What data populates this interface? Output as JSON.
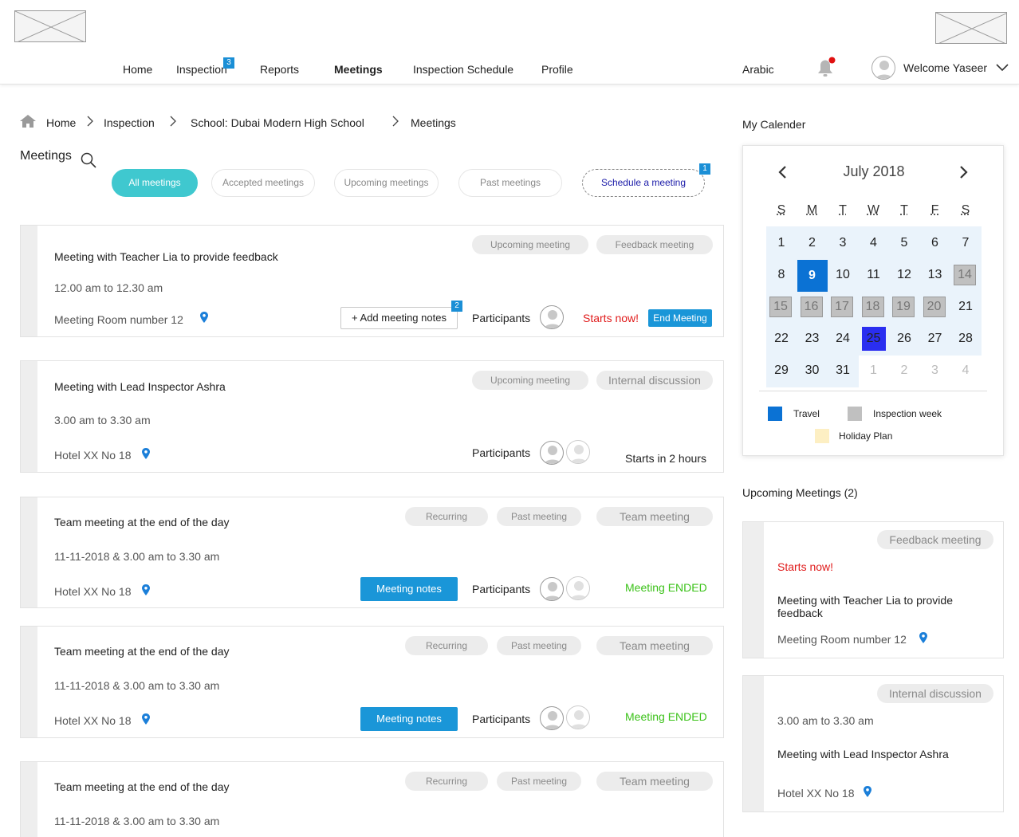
{
  "header": {
    "nav": [
      {
        "label": "Home"
      },
      {
        "label": "Inspection",
        "badge": "3"
      },
      {
        "label": "Reports"
      },
      {
        "label": "Meetings",
        "active": true
      },
      {
        "label": "Inspection Schedule"
      },
      {
        "label": "Profile"
      }
    ],
    "language": "Arabic",
    "welcome": "Welcome Yaseer",
    "icons": {
      "bell": "bell-icon",
      "avatar": "user-avatar-icon",
      "chevron": "chevron-down-icon"
    }
  },
  "breadcrumb": {
    "items": [
      "Home",
      "Inspection",
      "School: Dubai Modern High School",
      "Meetings"
    ],
    "icon": "home-icon"
  },
  "meetings": {
    "title": "Meetings",
    "filters": [
      "All meetings",
      "Accepted meetings",
      "Upcoming meetings",
      "Past meetings"
    ],
    "schedule_label": "Schedule a meeting",
    "schedule_badge": "1",
    "participants_label": "Participants",
    "cards": [
      {
        "title": "Meeting with Teacher Lia to provide feedback",
        "time": "12.00 am to 12.30 am",
        "location": "Meeting Room number 12",
        "tags": [
          "Upcoming meeting",
          "Feedback meeting"
        ],
        "action": "+ Add meeting notes",
        "action_badge": "2",
        "status": "Starts now!",
        "end_button": "End Meeting"
      },
      {
        "title": "Meeting with Lead Inspector Ashra",
        "time": "3.00 am to 3.30 am",
        "location": "Hotel XX No 18",
        "tags": [
          "Upcoming meeting",
          "Internal discussion"
        ],
        "status": "Starts in 2 hours"
      },
      {
        "title": "Team meeting at the end of the day",
        "time": "11-11-2018 & 3.00 am to 3.30 am",
        "location": "Hotel XX No 18",
        "tags": [
          "Recurring",
          "Past meeting",
          "Team meeting"
        ],
        "action": "Meeting notes",
        "status": "Meeting ENDED"
      },
      {
        "title": "Team meeting at the end of the day",
        "time": "11-11-2018 & 3.00 am to 3.30 am",
        "location": "Hotel XX No 18",
        "tags": [
          "Recurring",
          "Past meeting",
          "Team meeting"
        ],
        "action": "Meeting notes",
        "status": "Meeting ENDED"
      },
      {
        "title": "Team meeting at the end of the day",
        "time": "11-11-2018 & 3.00 am to 3.30 am",
        "location": "",
        "tags": [
          "Recurring",
          "Past meeting",
          "Team meeting"
        ]
      }
    ]
  },
  "calendar": {
    "label": "My Calender",
    "month": "July 2018",
    "weekdays": [
      "S",
      "M",
      "T",
      "W",
      "T",
      "F",
      "S"
    ],
    "weeks": [
      [
        "1",
        "2",
        "3",
        "4",
        "5",
        "6",
        "7"
      ],
      [
        "8",
        "9",
        "10",
        "11",
        "12",
        "13",
        "14"
      ],
      [
        "15",
        "16",
        "17",
        "18",
        "19",
        "20",
        "21"
      ],
      [
        "22",
        "23",
        "24",
        "25",
        "26",
        "27",
        "28"
      ],
      [
        "29",
        "30",
        "31",
        "1",
        "2",
        "3",
        "4"
      ]
    ],
    "legend": [
      {
        "label": "Travel",
        "color": "#0b72d4"
      },
      {
        "label": "Inspection week",
        "color": "#c0c0c0"
      },
      {
        "label": "Holiday Plan",
        "color": "#fdefc3"
      }
    ],
    "colors": {
      "today": "#0b72d4",
      "selected": "#2a2ef0",
      "inspection": "#c0c0c0",
      "month_bg": "#eaf3fb"
    }
  },
  "upcoming": {
    "title": "Upcoming Meetings (2)",
    "items": [
      {
        "tag": "Feedback meeting",
        "status": "Starts now!",
        "title": "Meeting with Teacher Lia to provide feedback",
        "location": "Meeting Room number 12"
      },
      {
        "tag": "Internal discussion",
        "time": "3.00 am to 3.30 am",
        "title": "Meeting with Lead Inspector Ashra",
        "location": "Hotel XX No 18"
      }
    ]
  }
}
